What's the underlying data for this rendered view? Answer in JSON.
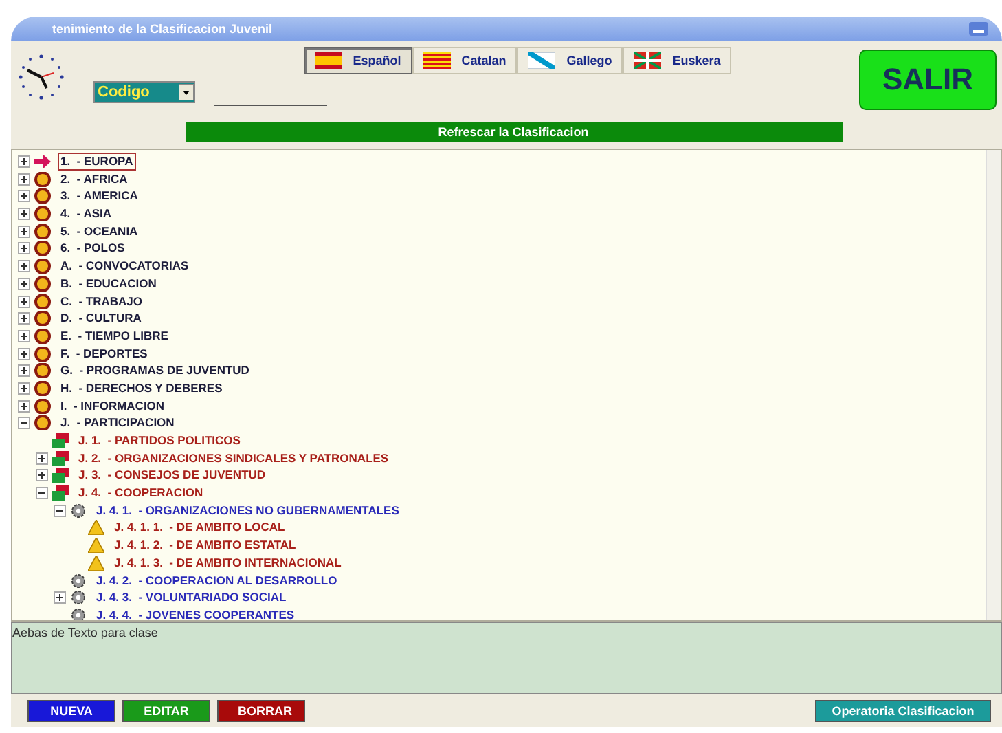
{
  "window": {
    "title": "tenimiento de la Clasificacion Juvenil"
  },
  "languages": [
    {
      "label": "Español",
      "kind": "es",
      "selected": true
    },
    {
      "label": "Catalan",
      "kind": "ca",
      "selected": false
    },
    {
      "label": "Gallego",
      "kind": "ga",
      "selected": false
    },
    {
      "label": "Euskera",
      "kind": "eu",
      "selected": false
    }
  ],
  "code_select": {
    "value": "Codigo"
  },
  "exit_button": "SALIR",
  "refresh_button": "Refrescar la Clasificacion",
  "tree": {
    "items": [
      {
        "text": "1.  - EUROPA",
        "expanded": false,
        "selected": true
      },
      {
        "text": "2.  - AFRICA",
        "expanded": false,
        "selected": false
      },
      {
        "text": "3.  - AMERICA",
        "expanded": false,
        "selected": false
      },
      {
        "text": "4.  - ASIA",
        "expanded": false,
        "selected": false
      },
      {
        "text": "5.  - OCEANIA",
        "expanded": false,
        "selected": false
      },
      {
        "text": "6.  - POLOS",
        "expanded": false,
        "selected": false
      },
      {
        "text": "A.  - CONVOCATORIAS",
        "expanded": false,
        "selected": false
      },
      {
        "text": "B.  - EDUCACION",
        "expanded": false,
        "selected": false
      },
      {
        "text": "C.  - TRABAJO",
        "expanded": false,
        "selected": false
      },
      {
        "text": "D.  - CULTURA",
        "expanded": false,
        "selected": false
      },
      {
        "text": "E.  - TIEMPO LIBRE",
        "expanded": false,
        "selected": false
      },
      {
        "text": "F.  - DEPORTES",
        "expanded": false,
        "selected": false
      },
      {
        "text": "G.  - PROGRAMAS DE JUVENTUD",
        "expanded": false,
        "selected": false
      },
      {
        "text": "H.  - DERECHOS Y DEBERES",
        "expanded": false,
        "selected": false
      },
      {
        "text": "I.  - INFORMACION",
        "expanded": false,
        "selected": false
      },
      {
        "text": "J.  - PARTICIPACION",
        "expanded": true,
        "selected": false,
        "children": [
          {
            "text": "J. 1.  - PARTIDOS POLITICOS",
            "selected": false
          },
          {
            "text": "J. 2.  - ORGANIZACIONES SINDICALES Y PATRONALES",
            "expanded": false,
            "selected": false
          },
          {
            "text": "J. 3.  - CONSEJOS DE JUVENTUD",
            "expanded": false,
            "selected": false
          },
          {
            "text": "J. 4.  - COOPERACION",
            "expanded": true,
            "selected": false,
            "children": [
              {
                "text": "J. 4. 1.  - ORGANIZACIONES NO GUBERNAMENTALES",
                "expanded": true,
                "selected": false,
                "children": [
                  {
                    "text": "J. 4. 1. 1.  - DE AMBITO LOCAL",
                    "selected": false
                  },
                  {
                    "text": "J. 4. 1. 2.  - DE AMBITO ESTATAL",
                    "selected": false
                  },
                  {
                    "text": "J. 4. 1. 3.  - DE AMBITO INTERNACIONAL",
                    "selected": false
                  }
                ]
              },
              {
                "text": "J. 4. 2.  - COOPERACION AL DESARROLLO",
                "selected": false
              },
              {
                "text": "J. 4. 3.  - VOLUNTARIADO SOCIAL",
                "expanded": false,
                "selected": false
              },
              {
                "text": "J. 4. 4.  - JOVENES COOPERANTES",
                "selected": false
              }
            ]
          }
        ]
      }
    ]
  },
  "notes": {
    "value": "Aebas de Texto para clase"
  },
  "actions": [
    {
      "label": "NUEVA",
      "kind": "new"
    },
    {
      "label": "EDITAR",
      "kind": "edit"
    },
    {
      "label": "BORRAR",
      "kind": "delete"
    }
  ],
  "operations_button": "Operatoria Clasificacion"
}
